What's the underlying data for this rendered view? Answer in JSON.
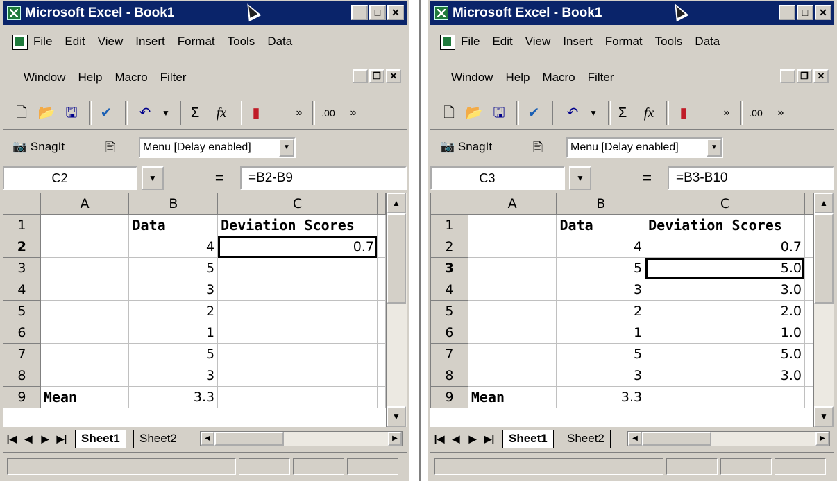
{
  "windows": [
    {
      "title": "Microsoft Excel - Book1",
      "menu_row1": [
        "File",
        "Edit",
        "View",
        "Insert",
        "Format",
        "Tools",
        "Data"
      ],
      "menu_row2": [
        "Window",
        "Help",
        "Macro",
        "Filter"
      ],
      "snagit_label": "SnagIt",
      "menu_combo": "Menu [Delay enabled]",
      "name_box": "C2",
      "formula": "=B2-B9",
      "columns": [
        "A",
        "B",
        "C"
      ],
      "rows": [
        {
          "row": "1",
          "a": "",
          "b": "Data",
          "c": "Deviation Scores"
        },
        {
          "row": "2",
          "a": "",
          "b": "4",
          "c": "0.7"
        },
        {
          "row": "3",
          "a": "",
          "b": "5",
          "c": ""
        },
        {
          "row": "4",
          "a": "",
          "b": "3",
          "c": ""
        },
        {
          "row": "5",
          "a": "",
          "b": "2",
          "c": ""
        },
        {
          "row": "6",
          "a": "",
          "b": "1",
          "c": ""
        },
        {
          "row": "7",
          "a": "",
          "b": "5",
          "c": ""
        },
        {
          "row": "8",
          "a": "",
          "b": "3",
          "c": ""
        },
        {
          "row": "9",
          "a": "Mean",
          "b": "3.3",
          "c": ""
        }
      ],
      "active_row": "2",
      "tabs": [
        "Sheet1",
        "Sheet2"
      ]
    },
    {
      "title": "Microsoft Excel - Book1",
      "menu_row1": [
        "File",
        "Edit",
        "View",
        "Insert",
        "Format",
        "Tools",
        "Data"
      ],
      "menu_row2": [
        "Window",
        "Help",
        "Macro",
        "Filter"
      ],
      "snagit_label": "SnagIt",
      "menu_combo": "Menu [Delay enabled]",
      "name_box": "C3",
      "formula": "=B3-B10",
      "columns": [
        "A",
        "B",
        "C"
      ],
      "rows": [
        {
          "row": "1",
          "a": "",
          "b": "Data",
          "c": "Deviation Scores"
        },
        {
          "row": "2",
          "a": "",
          "b": "4",
          "c": "0.7"
        },
        {
          "row": "3",
          "a": "",
          "b": "5",
          "c": "5.0"
        },
        {
          "row": "4",
          "a": "",
          "b": "3",
          "c": "3.0"
        },
        {
          "row": "5",
          "a": "",
          "b": "2",
          "c": "2.0"
        },
        {
          "row": "6",
          "a": "",
          "b": "1",
          "c": "1.0"
        },
        {
          "row": "7",
          "a": "",
          "b": "5",
          "c": "5.0"
        },
        {
          "row": "8",
          "a": "",
          "b": "3",
          "c": "3.0"
        },
        {
          "row": "9",
          "a": "Mean",
          "b": "3.3",
          "c": ""
        }
      ],
      "active_row": "3",
      "tabs": [
        "Sheet1",
        "Sheet2"
      ]
    }
  ],
  "icons": [
    "excel-app-icon",
    "minimize-icon",
    "maximize-icon",
    "close-icon",
    "new-doc-icon",
    "open-folder-icon",
    "save-icon",
    "spellcheck-icon",
    "undo-icon",
    "autosum-icon",
    "function-icon",
    "chart-wizard-icon",
    "more-buttons-icon",
    "decimal-icon",
    "camera-icon",
    "snagit-profile-icon",
    "dropdown-arrow-icon",
    "scroll-up-icon",
    "scroll-down-icon",
    "mouse-cursor-icon"
  ],
  "colors": {
    "titlebar": "#0a246a",
    "chrome": "#d4d0c8",
    "selection_border": "#000000"
  }
}
